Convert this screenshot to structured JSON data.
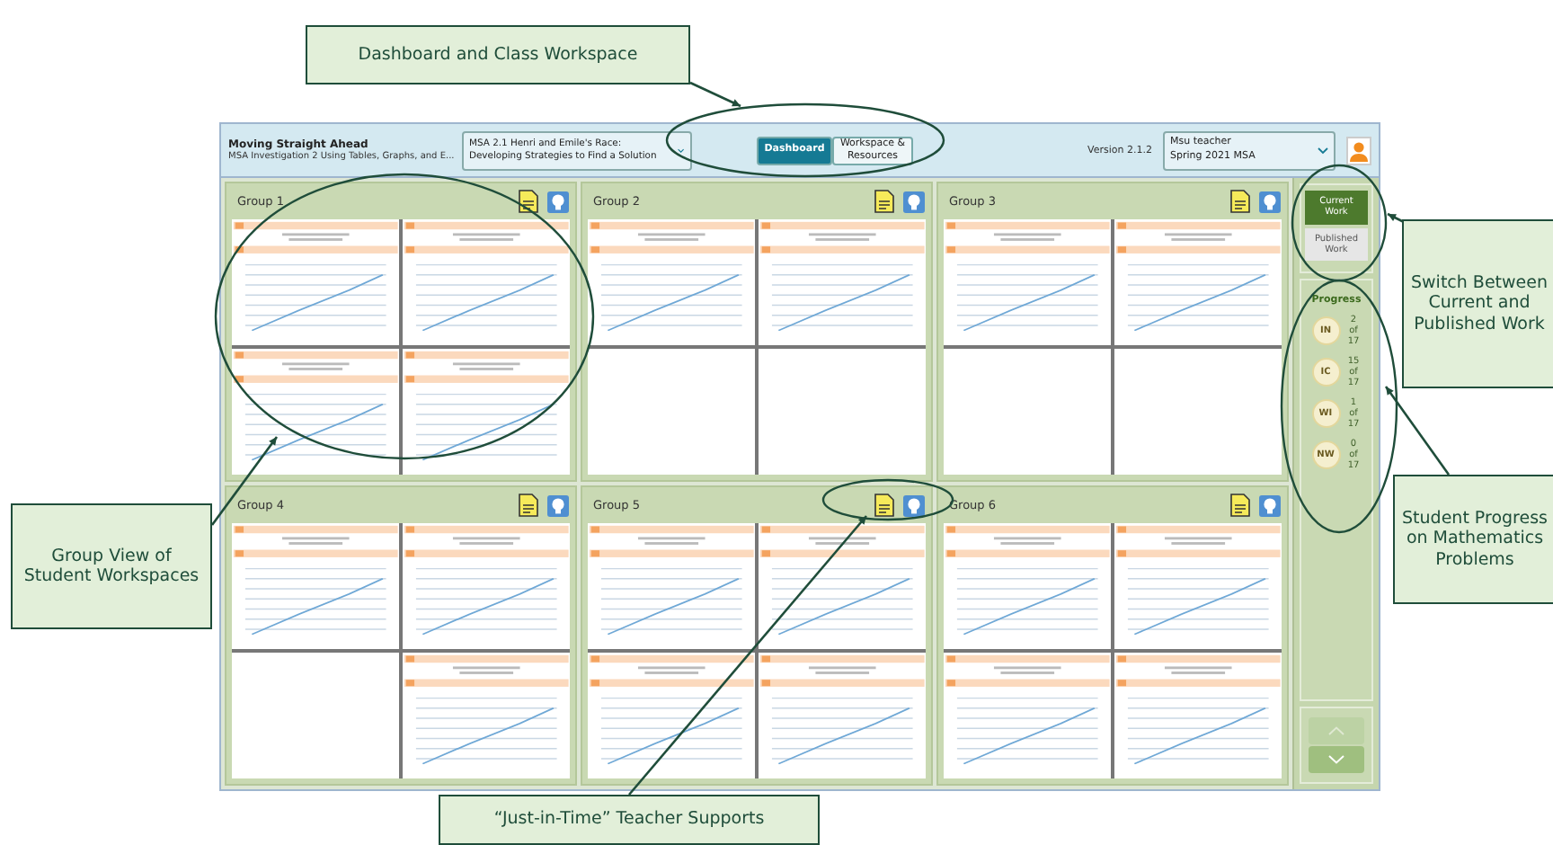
{
  "header": {
    "unit_title": "Moving Straight Ahead",
    "unit_subtitle": "MSA Investigation 2 Using Tables, Graphs, and E...",
    "problem": "MSA 2.1 Henri and Emile's Race: Developing Strategies to Find a Solution",
    "tabs": [
      {
        "label": "Dashboard",
        "selected": true
      },
      {
        "label": "Workspace & Resources",
        "selected": false
      }
    ],
    "version": "Version 2.1.2",
    "user": "Msu teacher",
    "class": "Spring 2021 MSA"
  },
  "groups": [
    {
      "name": "Group 1",
      "quadrants": [
        {
          "kind": "workspace"
        },
        {
          "kind": "workspace"
        },
        {
          "kind": "workspace"
        },
        {
          "kind": "workspace"
        }
      ]
    },
    {
      "name": "Group 2",
      "quadrants": [
        {
          "kind": "workspace"
        },
        {
          "kind": "workspace"
        },
        {
          "kind": "empty"
        },
        {
          "kind": "empty"
        }
      ]
    },
    {
      "name": "Group 3",
      "quadrants": [
        {
          "kind": "workspace"
        },
        {
          "kind": "workspace"
        },
        {
          "kind": "empty"
        },
        {
          "kind": "empty"
        }
      ]
    },
    {
      "name": "Group 4",
      "quadrants": [
        {
          "kind": "workspace"
        },
        {
          "kind": "workspace"
        },
        {
          "kind": "empty"
        },
        {
          "kind": "workspace"
        }
      ]
    },
    {
      "name": "Group 5",
      "quadrants": [
        {
          "kind": "workspace"
        },
        {
          "kind": "workspace"
        },
        {
          "kind": "workspace"
        },
        {
          "kind": "workspace"
        }
      ]
    },
    {
      "name": "Group 6",
      "quadrants": [
        {
          "kind": "workspace"
        },
        {
          "kind": "workspace"
        },
        {
          "kind": "workspace"
        },
        {
          "kind": "workspace"
        }
      ]
    }
  ],
  "sidebar": {
    "views": [
      {
        "label": "Current Work",
        "selected": true
      },
      {
        "label": "Published Work",
        "selected": false
      }
    ],
    "progress_title": "Progress",
    "progress": [
      {
        "code": "IN",
        "reading": "2 of 17"
      },
      {
        "code": "IC",
        "reading": "15 of 17"
      },
      {
        "code": "WI",
        "reading": "1 of 17"
      },
      {
        "code": "NW",
        "reading": "0 of 17"
      }
    ]
  },
  "callouts": [
    {
      "text": "Dashboard and Class Workspace"
    },
    {
      "text": "Switch Between Current and Published Work"
    },
    {
      "text": "Student Progress on Mathematics Problems"
    },
    {
      "text": "Group View of Student Workspaces"
    },
    {
      "text": "“Just-in-Time” Teacher Supports"
    }
  ]
}
